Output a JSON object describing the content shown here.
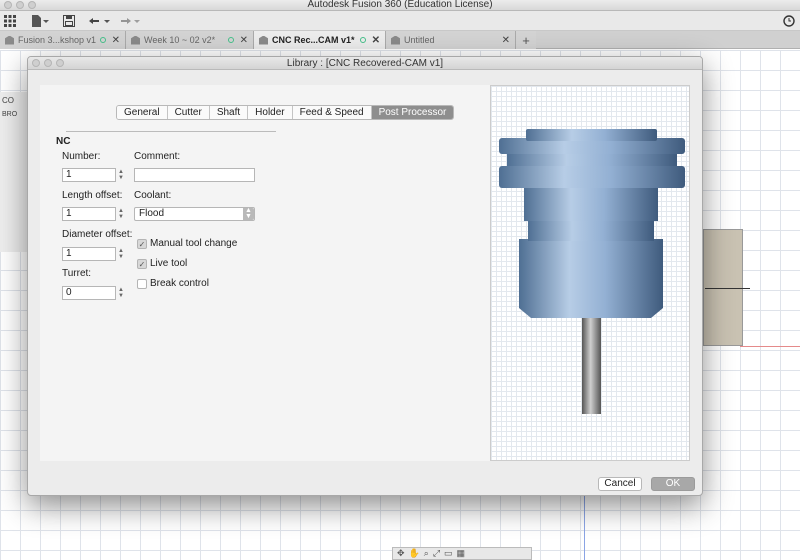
{
  "app": {
    "title": "Autodesk Fusion 360 (Education License)"
  },
  "tabs": [
    {
      "label": "Fusion 3...kshop v1",
      "active": false
    },
    {
      "label": "Week 10 ~ 02 v2*",
      "active": false
    },
    {
      "label": "CNC Rec...CAM v1*",
      "active": true
    },
    {
      "label": "Untitled",
      "active": false
    }
  ],
  "left_panel": {
    "label": "CO",
    "label2": "BRO"
  },
  "dialog": {
    "title": "Library : [CNC Recovered-CAM v1]",
    "tabs": [
      "General",
      "Cutter",
      "Shaft",
      "Holder",
      "Feed & Speed",
      "Post Processor"
    ],
    "active_tab": "Post Processor",
    "section": "NC",
    "fields": {
      "number": {
        "label": "Number:",
        "value": "1"
      },
      "length_offset": {
        "label": "Length offset:",
        "value": "1"
      },
      "diameter_offset": {
        "label": "Diameter offset:",
        "value": "1"
      },
      "turret": {
        "label": "Turret:",
        "value": "0"
      },
      "comment": {
        "label": "Comment:",
        "value": ""
      },
      "coolant": {
        "label": "Coolant:",
        "value": "Flood"
      }
    },
    "checkboxes": [
      {
        "label": "Manual tool change",
        "checked": true
      },
      {
        "label": "Live tool",
        "checked": true
      },
      {
        "label": "Break control",
        "checked": false
      }
    ],
    "buttons": {
      "cancel": "Cancel",
      "ok": "OK"
    }
  },
  "colors": {
    "accent_tab": "#8e8e8e",
    "tool_blue": "#8fb0d6",
    "tool_shank": "#9a9a9a",
    "model": "#c9c2b2"
  }
}
